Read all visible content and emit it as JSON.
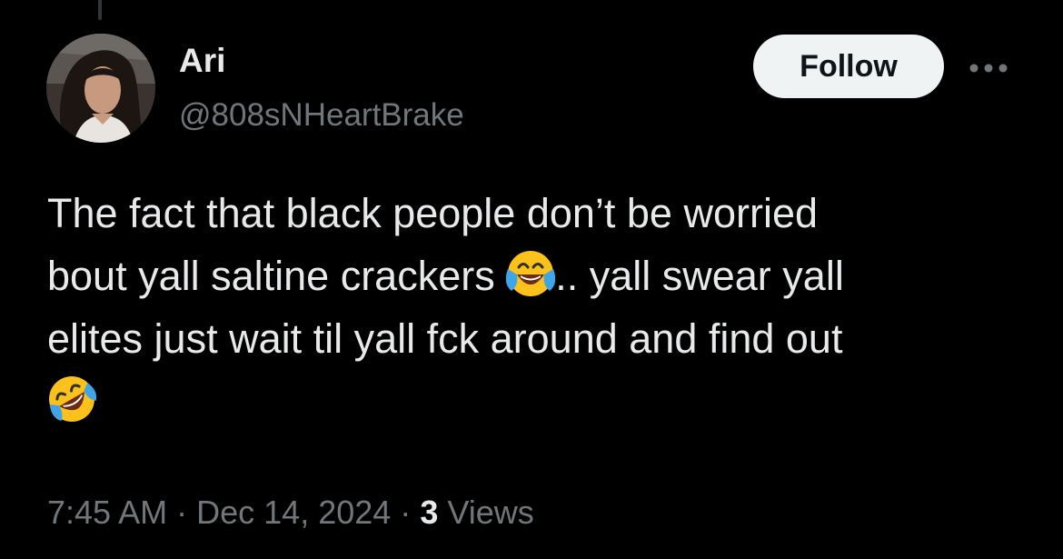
{
  "author": {
    "display_name": "Ari",
    "handle": "@808sNHeartBrake"
  },
  "actions": {
    "follow_label": "Follow",
    "more_icon": "more-horizontal-icon"
  },
  "tweet": {
    "line1": "The fact that black people don’t be worried",
    "line2_before": "bout yall saltine crackers ",
    "line2_emoji": "face-with-tears-of-joy-icon",
    "line2_after": ".. yall swear yall",
    "line3": "elites just wait til yall fck around and find out",
    "line4_emoji": "rolling-on-the-floor-laughing-icon"
  },
  "meta": {
    "time": "7:45 AM",
    "separator": "·",
    "date": "Dec 14, 2024",
    "views_count": "3",
    "views_label": "Views"
  },
  "colors": {
    "background": "#000000",
    "primary_text": "#e7e9ea",
    "secondary_text": "#71767b",
    "follow_bg": "#eff3f4",
    "follow_text": "#0f1419"
  }
}
